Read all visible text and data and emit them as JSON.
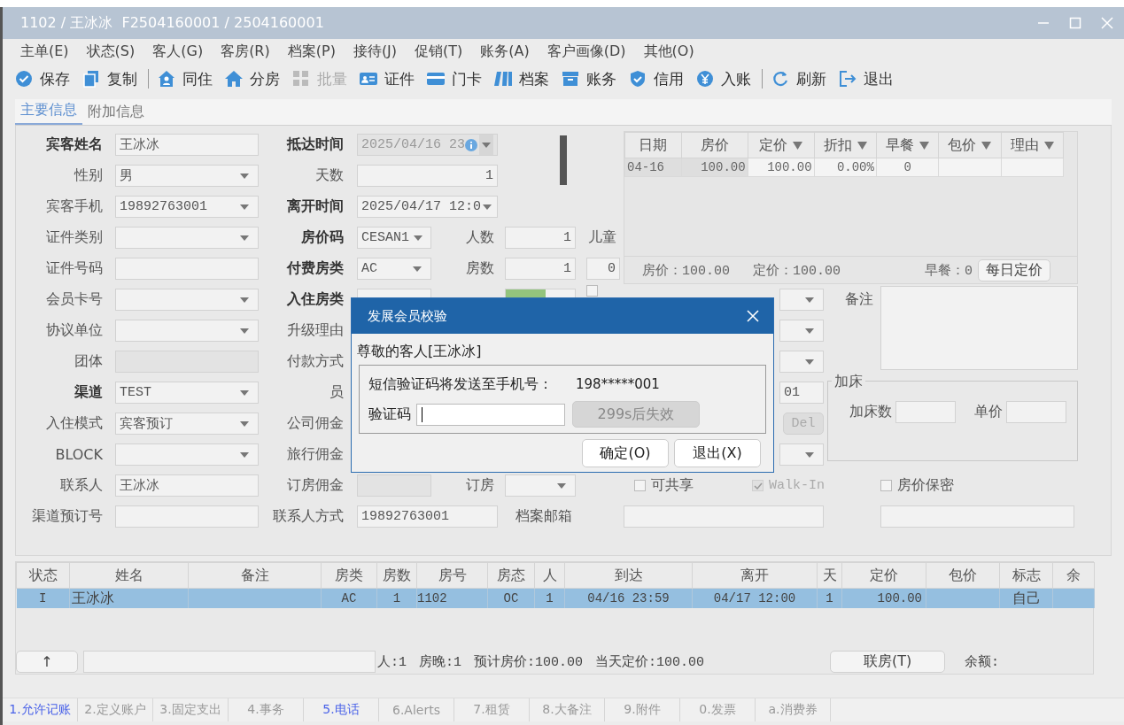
{
  "window": {
    "title": "1102 / 王冰冰  F2504160001 / 2504160001"
  },
  "menu": [
    "主单(E)",
    "状态(S)",
    "客人(G)",
    "客房(R)",
    "档案(P)",
    "接待(J)",
    "促销(T)",
    "账务(A)",
    "客户画像(D)",
    "其他(O)"
  ],
  "toolbar": [
    {
      "kind": "button",
      "label": "保存",
      "disabled": false
    },
    {
      "kind": "button",
      "label": "复制",
      "disabled": false
    },
    {
      "kind": "separator"
    },
    {
      "kind": "button",
      "label": "同住",
      "disabled": false
    },
    {
      "kind": "button",
      "label": "分房",
      "disabled": false
    },
    {
      "kind": "button",
      "label": "批量",
      "disabled": true
    },
    {
      "kind": "button",
      "label": "证件",
      "disabled": false
    },
    {
      "kind": "button",
      "label": "门卡",
      "disabled": false
    },
    {
      "kind": "button",
      "label": "档案",
      "disabled": false
    },
    {
      "kind": "button",
      "label": "账务",
      "disabled": false
    },
    {
      "kind": "button",
      "label": "信用",
      "disabled": false
    },
    {
      "kind": "button",
      "label": "入账",
      "disabled": false
    },
    {
      "kind": "separator"
    },
    {
      "kind": "button",
      "label": "刷新",
      "disabled": false
    },
    {
      "kind": "button",
      "label": "退出",
      "disabled": false
    }
  ],
  "tabs": [
    {
      "label": "主要信息",
      "selected": true
    },
    {
      "label": "附加信息",
      "selected": false
    }
  ],
  "form": {
    "rows": [
      {
        "items": [
          {
            "kind": "label",
            "text": "宾客姓名",
            "required": true
          },
          {
            "kind": "text",
            "value": "王冰冰",
            "disabled": false
          },
          {
            "kind": "label",
            "text": "抵达时间",
            "required": true
          },
          {
            "kind": "date",
            "value": "2025/04/16 23",
            "disabled": true
          }
        ]
      },
      {
        "items": [
          {
            "kind": "label",
            "text": "性别",
            "required": false
          },
          {
            "kind": "combo",
            "value": "男",
            "disabled": false
          },
          {
            "kind": "label",
            "text": "天数",
            "required": false
          },
          {
            "kind": "number",
            "value": "1",
            "disabled": false
          }
        ]
      },
      {
        "items": [
          {
            "kind": "label",
            "text": "宾客手机",
            "required": false
          },
          {
            "kind": "combo",
            "value": "19892763001",
            "disabled": false
          },
          {
            "kind": "label",
            "text": "离开时间",
            "required": true
          },
          {
            "kind": "combo",
            "value": "2025/04/17 12:0",
            "disabled": false
          }
        ]
      },
      {
        "items": [
          {
            "kind": "label",
            "text": "证件类别",
            "required": false
          },
          {
            "kind": "combo",
            "disabled": false
          },
          {
            "kind": "label",
            "text": "房价码",
            "required": true
          },
          {
            "kind": "combo",
            "value": "CESAN1",
            "disabled": false
          },
          {
            "kind": "label",
            "text": "人数",
            "required": false
          },
          {
            "kind": "number",
            "value": "1",
            "disabled": false
          },
          {
            "kind": "label",
            "text": "儿童",
            "required": false
          }
        ]
      },
      {
        "items": [
          {
            "kind": "label",
            "text": "证件号码",
            "required": false
          },
          {
            "kind": "text",
            "disabled": false
          },
          {
            "kind": "label",
            "text": "付费房类",
            "required": true
          },
          {
            "kind": "combo",
            "value": "AC",
            "disabled": false
          },
          {
            "kind": "label",
            "text": "房数",
            "required": false
          },
          {
            "kind": "number",
            "value": "1",
            "disabled": false
          },
          {
            "kind": "number",
            "value": "0",
            "disabled": false
          }
        ]
      },
      {
        "items": [
          {
            "kind": "label",
            "text": "会员卡号",
            "required": false
          },
          {
            "kind": "combo",
            "disabled": false
          },
          {
            "kind": "label",
            "text": "入住房类",
            "required": true
          },
          {
            "kind": "combo",
            "disabled": false
          },
          {
            "kind": "room",
            "disabled": false
          },
          {
            "kind": "check",
            "checked": false,
            "disabled": false
          },
          {
            "kind": "combo",
            "disabled": false
          },
          {
            "kind": "label",
            "text": "备注",
            "required": false
          },
          {
            "kind": "memo",
            "disabled": false
          }
        ]
      },
      {
        "items": [
          {
            "kind": "label",
            "text": "协议单位",
            "required": false
          },
          {
            "kind": "combo",
            "disabled": false
          },
          {
            "kind": "label",
            "text": "升级理由",
            "required": false
          },
          {
            "kind": "combo",
            "disabled": false
          }
        ]
      },
      {
        "items": [
          {
            "kind": "label",
            "text": "团体",
            "required": false
          },
          {
            "kind": "text",
            "disabled": true
          },
          {
            "kind": "label",
            "text": "付款方式",
            "required": false
          },
          {
            "kind": "combo",
            "disabled": false
          }
        ]
      },
      {
        "items": [
          {
            "kind": "label",
            "text": "渠道",
            "required": true
          },
          {
            "kind": "combo",
            "value": "TEST",
            "disabled": false
          },
          {
            "kind": "label",
            "text": "员",
            "required": false
          },
          {
            "kind": "text",
            "value": "01",
            "disabled": false
          },
          {
            "kind": "group",
            "title": "加床",
            "fields": [
              {
                "kind": "label",
                "text": "加床数",
                "required": false
              },
              {
                "kind": "text",
                "disabled": false
              },
              {
                "kind": "label",
                "text": "单价",
                "required": false
              },
              {
                "kind": "text",
                "disabled": false
              }
            ]
          }
        ]
      },
      {
        "items": [
          {
            "kind": "label",
            "text": "入住模式",
            "required": false
          },
          {
            "kind": "combo",
            "value": "宾客预订",
            "disabled": false
          },
          {
            "kind": "label",
            "text": "公司佣金",
            "required": false
          },
          {
            "kind": "button",
            "label": "Del",
            "disabled": true
          }
        ]
      },
      {
        "items": [
          {
            "kind": "label",
            "text": "BLOCK",
            "required": false
          },
          {
            "kind": "combo",
            "disabled": false
          },
          {
            "kind": "label",
            "text": "旅行佣金",
            "required": false
          },
          {
            "kind": "combo",
            "disabled": false
          }
        ]
      },
      {
        "items": [
          {
            "kind": "label",
            "text": "联系人",
            "required": false
          },
          {
            "kind": "text",
            "value": "王冰冰",
            "disabled": false
          },
          {
            "kind": "label",
            "text": "订房佣金",
            "required": false
          },
          {
            "kind": "text",
            "disabled": true
          },
          {
            "kind": "label",
            "text": "订房",
            "required": false
          },
          {
            "kind": "combo",
            "disabled": false
          },
          {
            "kind": "check",
            "label": "可共享",
            "checked": false,
            "disabled": false
          },
          {
            "kind": "check",
            "label": "Walk-In",
            "checked": true,
            "disabled": true
          },
          {
            "kind": "check",
            "label": "房价保密",
            "checked": false,
            "disabled": false
          }
        ]
      },
      {
        "items": [
          {
            "kind": "label",
            "text": "渠道预订号",
            "required": false
          },
          {
            "kind": "text",
            "disabled": false
          },
          {
            "kind": "label",
            "text": "联系人方式",
            "required": false
          },
          {
            "kind": "text",
            "value": "19892763001",
            "disabled": false
          },
          {
            "kind": "label",
            "text": "档案邮箱",
            "required": false
          },
          {
            "kind": "text",
            "disabled": false
          },
          {
            "kind": "text",
            "disabled": false
          }
        ]
      }
    ]
  },
  "price_grid": {
    "columns": [
      {
        "label": "日期",
        "filter": false
      },
      {
        "label": "房价",
        "filter": false
      },
      {
        "label": "定价",
        "filter": true
      },
      {
        "label": "折扣",
        "filter": true
      },
      {
        "label": "早餐",
        "filter": true
      },
      {
        "label": "包价",
        "filter": true
      },
      {
        "label": "理由",
        "filter": true
      }
    ],
    "rows": [
      [
        "04-16",
        "100.00",
        "100.00",
        "0.00%",
        "0",
        null,
        null
      ]
    ],
    "summary": [
      "房价：100.00",
      "定价：100.00",
      "早餐：0"
    ],
    "button": "每日定价"
  },
  "guest_table": {
    "columns": [
      "状态",
      "姓名",
      "备注",
      "房类",
      "房数",
      "房号",
      "房态",
      "人",
      "到达",
      "离开",
      "天",
      "定价",
      "包价",
      "标志",
      "余"
    ],
    "rows": [
      {
        "selected": true,
        "cells": [
          "I",
          "王冰冰",
          null,
          "AC",
          "1",
          "1102",
          "OC",
          "1",
          "04/16 23:59",
          "04/17 12:00",
          "1",
          "100.00",
          null,
          "自己",
          null
        ]
      }
    ],
    "footer": {
      "up_button": "↑",
      "stats": [
        "人:1",
        "房晚:1",
        "预计房价:100.00",
        "当天定价:100.00"
      ],
      "link_button": "联房(T)",
      "balance_label": "余额:"
    }
  },
  "bottom_tabs": [
    {
      "label": "1.允许记账",
      "active": true
    },
    {
      "label": "2.定义账户",
      "active": false
    },
    {
      "label": "3.固定支出",
      "active": false
    },
    {
      "label": "4.事务",
      "active": false
    },
    {
      "label": "5.电话",
      "active": true
    },
    {
      "label": "6.Alerts",
      "active": false
    },
    {
      "label": "7.租赁",
      "active": false
    },
    {
      "label": "8.大备注",
      "active": false
    },
    {
      "label": "9.附件",
      "active": false
    },
    {
      "label": "0.发票",
      "active": false
    },
    {
      "label": "a.消费券",
      "active": false
    }
  ],
  "dialog": {
    "title": "发展会员校验",
    "greeting": "尊敬的客人[王冰冰]",
    "sms_label": "短信验证码将发送至手机号：",
    "phone": "198*****001",
    "code_label": "验证码",
    "countdown": "299s后失效",
    "countdown_disabled": true,
    "buttons": [
      "确定(O)",
      "退出(X)"
    ]
  }
}
